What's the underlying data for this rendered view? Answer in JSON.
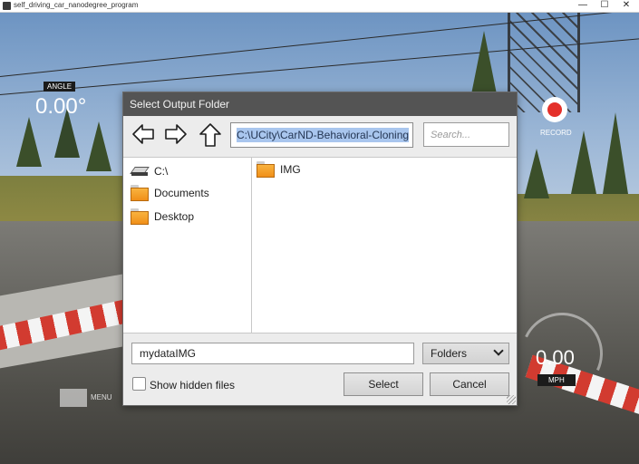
{
  "window": {
    "title": "self_driving_car_nanodegree_program",
    "minimize": "—",
    "maximize": "☐",
    "close": "✕"
  },
  "hud": {
    "angle_label": "ANGLE",
    "angle_value": "0.00°",
    "record_label": "RECORD",
    "speed_value": "0.00",
    "speed_unit": "MPH",
    "menu_label": "MENU"
  },
  "dialog": {
    "title": "Select Output Folder",
    "path": "C:\\UCity\\CarND-Behavioral-Cloning",
    "search_placeholder": "Search...",
    "tree": [
      {
        "label": "C:\\",
        "icon": "drive-icon"
      },
      {
        "label": "Documents",
        "icon": "folder-icon"
      },
      {
        "label": "Desktop",
        "icon": "folder-icon"
      }
    ],
    "files": [
      {
        "label": "IMG",
        "icon": "folder-icon"
      }
    ],
    "filename": "mydataIMG",
    "filter": "Folders",
    "show_hidden": "Show hidden files",
    "select_label": "Select",
    "cancel_label": "Cancel"
  },
  "colors": {
    "dialog_header": "#545454",
    "record_red": "#e4302a",
    "folder_orange": "#f5a22c",
    "path_highlight": "#a9c6ee"
  }
}
